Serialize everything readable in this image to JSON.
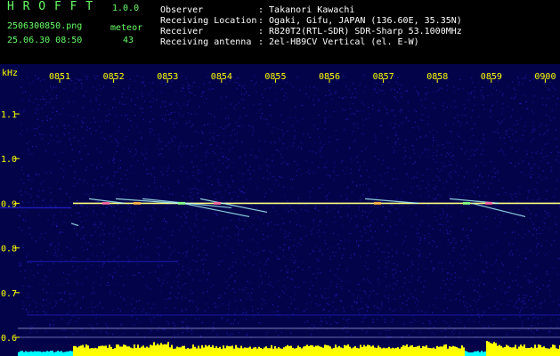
{
  "header": {
    "app_name": "H R O F F T",
    "version": "1.0.0",
    "filename": "2506300850.png",
    "meteor_label": "meteor",
    "datetime": "25.06.30 08:50",
    "meteor_count": "43",
    "info": [
      {
        "label": "Observer",
        "value": ": Takanori Kawachi"
      },
      {
        "label": "Receiving Location",
        "value": ": Ogaki, Gifu, JAPAN (136.60E, 35.35N)"
      },
      {
        "label": "Receiver",
        "value": ": R820T2(RTL-SDR) SDR-Sharp 53.1000MHz"
      },
      {
        "label": "Receiving antenna",
        "value": ": 2el-HB9CV Vertical (el. E-W)"
      }
    ]
  },
  "spectrogram": {
    "unit_label": "kHz",
    "time_labels": [
      "0851",
      "0852",
      "0853",
      "0854",
      "0855",
      "0856",
      "0857",
      "0858",
      "0859",
      "0900"
    ],
    "freq_labels": [
      "1.1",
      "1.0",
      "0.9",
      "0.8",
      "0.7",
      "0.6"
    ],
    "freq_values": [
      1.1,
      1.0,
      0.9,
      0.8,
      0.7,
      0.6
    ],
    "colors": {
      "background": "#03034a",
      "noise": "#2020c8",
      "tick_label": "#ffff00",
      "carrier": "#ffff80",
      "bar_yellow": "#ffff00",
      "bar_cyan": "#00ffff",
      "guide_line": "#c8c8ff"
    }
  }
}
